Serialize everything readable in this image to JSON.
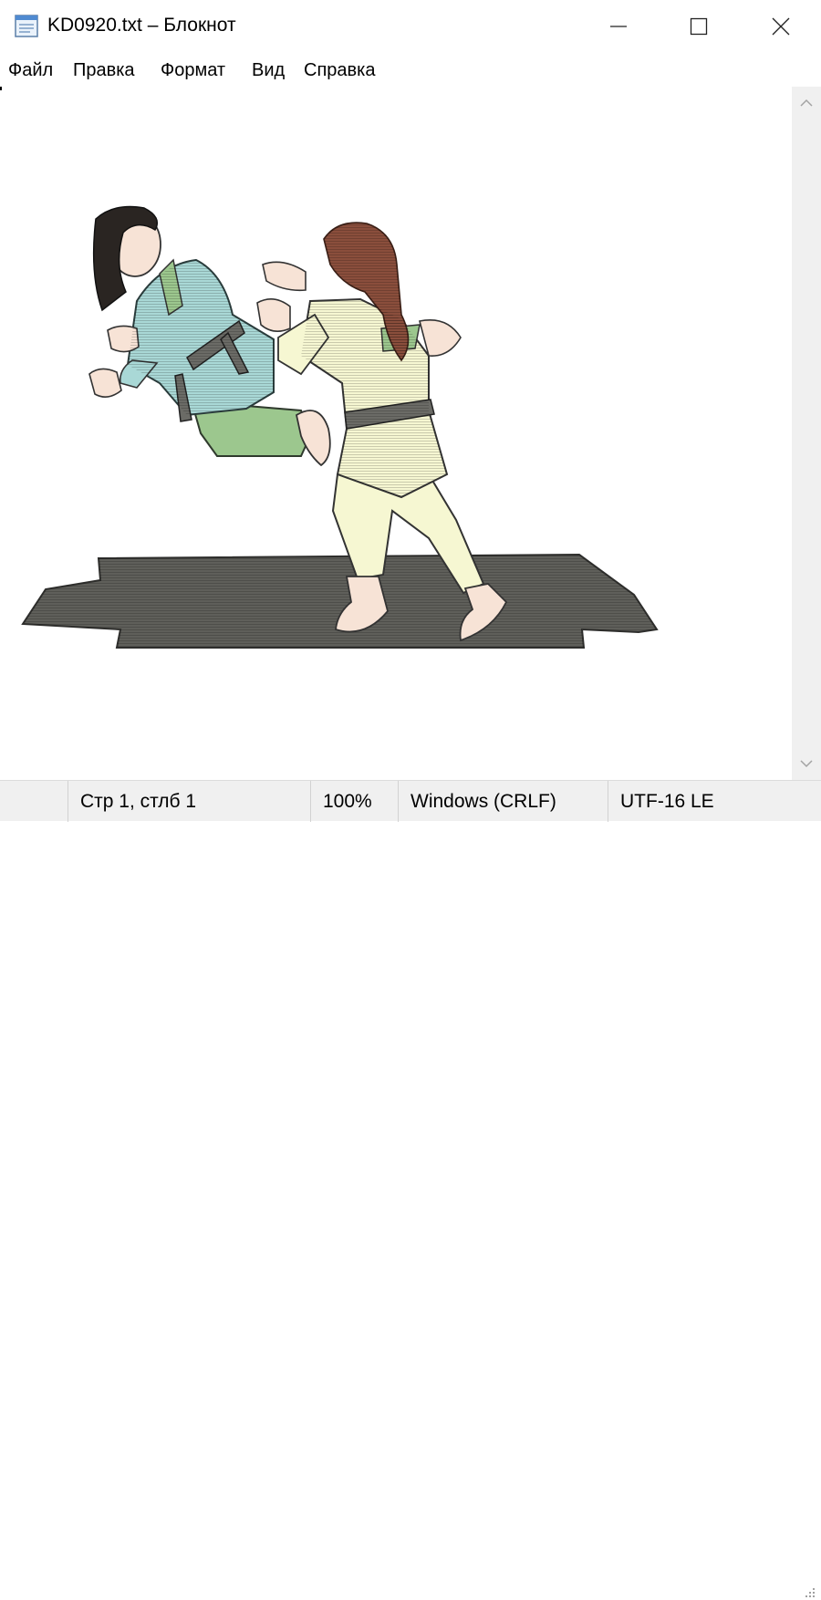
{
  "window": {
    "title": "KD0920.txt – Блокнот",
    "icons": {
      "app": "notepad-icon",
      "minimize": "minimize-icon",
      "maximize": "maximize-icon",
      "close": "close-icon"
    }
  },
  "menu": {
    "items": [
      "Файл",
      "Правка",
      "Формат",
      "Вид",
      "Справка"
    ]
  },
  "document": {
    "content_image": "judo-clipart-two-girls-throw",
    "colors": {
      "left_gi": "#a9d8d6",
      "left_trousers": "#9cc78e",
      "right_gi": "#f6f7d2",
      "mat": "#5f5f5a",
      "hair": "#8a4e3c",
      "skin": "#f7e3d6"
    }
  },
  "statusbar": {
    "position": "Стр 1, стлб 1",
    "zoom": "100%",
    "line_endings": "Windows (CRLF)",
    "encoding": "UTF-16 LE"
  }
}
